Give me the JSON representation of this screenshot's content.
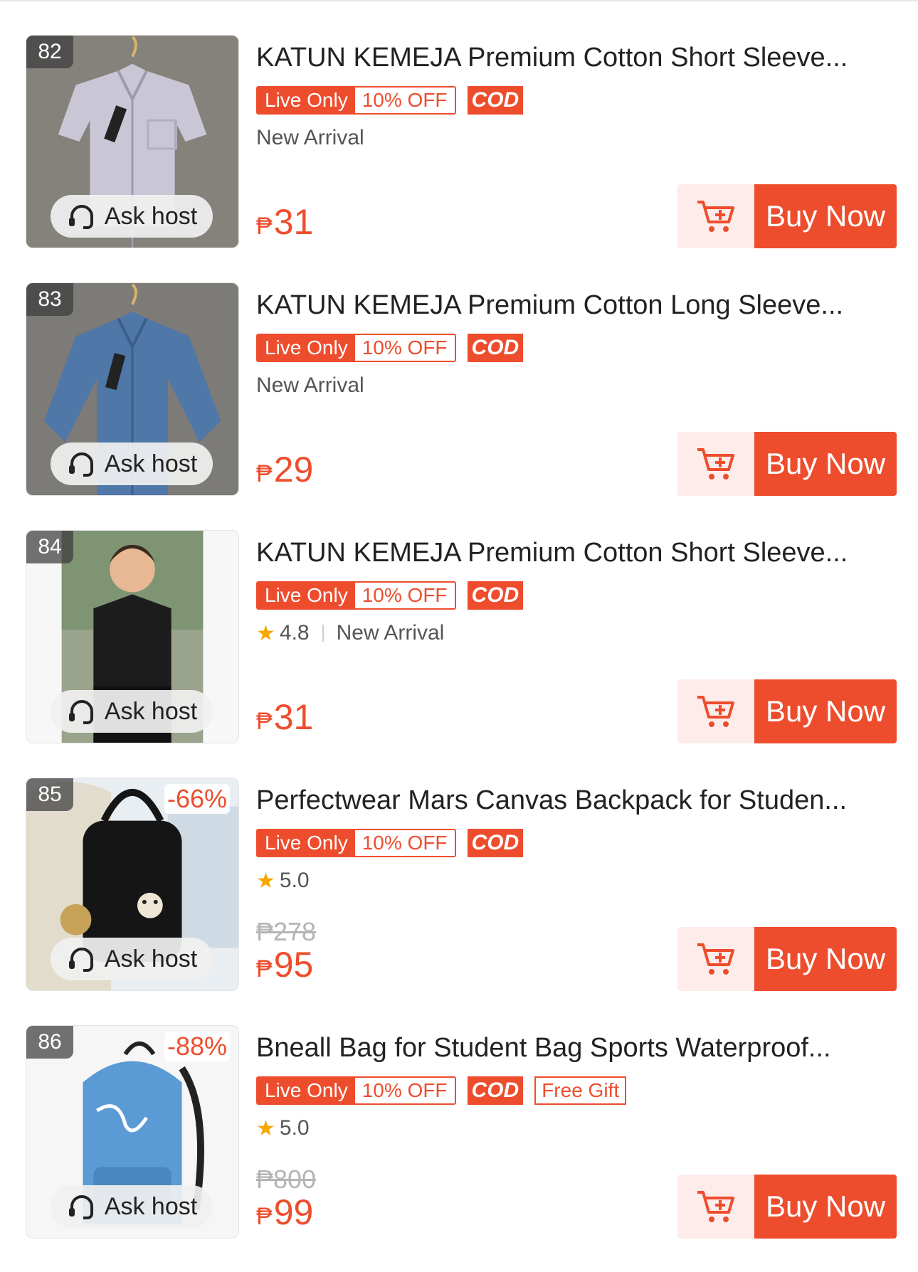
{
  "colors": {
    "accent": "#ee4d2d",
    "star": "#f6a700"
  },
  "common": {
    "ask_host": "Ask host",
    "live_only": "Live Only",
    "off_label": "10% OFF",
    "cod": "COD",
    "buy_now": "Buy Now",
    "currency": "₱"
  },
  "items": [
    {
      "rank": "82",
      "title": "KATUN KEMEJA Premium Cotton Short Sleeve...",
      "discount": "",
      "rating": "",
      "meta_text": "New Arrival",
      "free_gift": "",
      "original_price": "",
      "price": "31"
    },
    {
      "rank": "83",
      "title": "KATUN KEMEJA Premium Cotton Long Sleeve...",
      "discount": "",
      "rating": "",
      "meta_text": "New Arrival",
      "free_gift": "",
      "original_price": "",
      "price": "29"
    },
    {
      "rank": "84",
      "title": "KATUN KEMEJA Premium Cotton Short Sleeve...",
      "discount": "",
      "rating": "4.8",
      "meta_text": "New Arrival",
      "free_gift": "",
      "original_price": "",
      "price": "31"
    },
    {
      "rank": "85",
      "title": "Perfectwear Mars Canvas Backpack for Studen...",
      "discount": "-66%",
      "rating": "5.0",
      "meta_text": "",
      "free_gift": "",
      "original_price": "₱278",
      "price": "95"
    },
    {
      "rank": "86",
      "title": "Bneall Bag for Student Bag Sports Waterproof...",
      "discount": "-88%",
      "rating": "5.0",
      "meta_text": "",
      "free_gift": "Free Gift",
      "original_price": "₱800",
      "price": "99"
    }
  ]
}
